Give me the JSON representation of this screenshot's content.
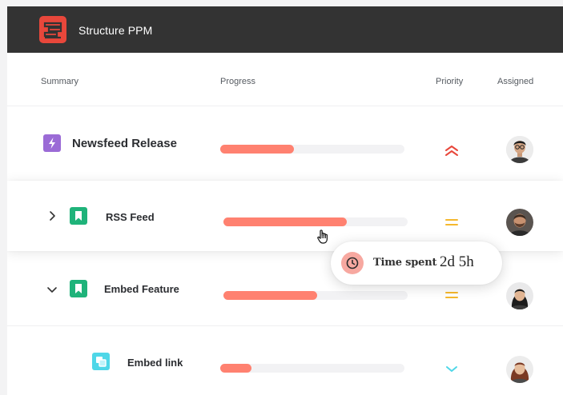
{
  "app": {
    "title": "Structure PPM",
    "accent_color": "#e8473b",
    "logo_icon": "structure-logo-icon"
  },
  "columns": {
    "summary": "Summary",
    "progress": "Progress",
    "priority": "Priority",
    "assigned": "Assigned"
  },
  "rows": [
    {
      "label": "Newsfeed Release",
      "type_icon": "epic-lightning-icon",
      "type_color": "#9b6bd6",
      "progress": 0.4,
      "priority": "highest",
      "priority_icon": "double-chevron-up-icon",
      "priority_color": "#e8473b",
      "assignee_avatar": "avatar-man-glasses"
    },
    {
      "label": "RSS Feed",
      "type_icon": "story-bookmark-icon",
      "type_color": "#1fb37a",
      "progress": 0.67,
      "priority": "medium",
      "priority_icon": "equals-icon",
      "priority_color": "#f5b82e",
      "assignee_avatar": "avatar-man-beard",
      "expander": "chevron-right-icon"
    },
    {
      "label": "Embed Feature",
      "type_icon": "story-bookmark-icon",
      "type_color": "#1fb37a",
      "progress": 0.51,
      "priority": "medium",
      "priority_icon": "equals-icon",
      "priority_color": "#f5b82e",
      "assignee_avatar": "avatar-woman-dark-hair",
      "expander": "chevron-down-icon"
    },
    {
      "label": "Embed link",
      "type_icon": "subtask-icon",
      "type_color": "#4fd7e8",
      "progress": 0.17,
      "priority": "low",
      "priority_icon": "chevron-down-icon",
      "priority_color": "#4fd7e8",
      "assignee_avatar": "avatar-woman-red-hair"
    }
  ],
  "tooltip": {
    "label": "Time spent",
    "value": "2d 5h",
    "icon": "clock-icon"
  }
}
